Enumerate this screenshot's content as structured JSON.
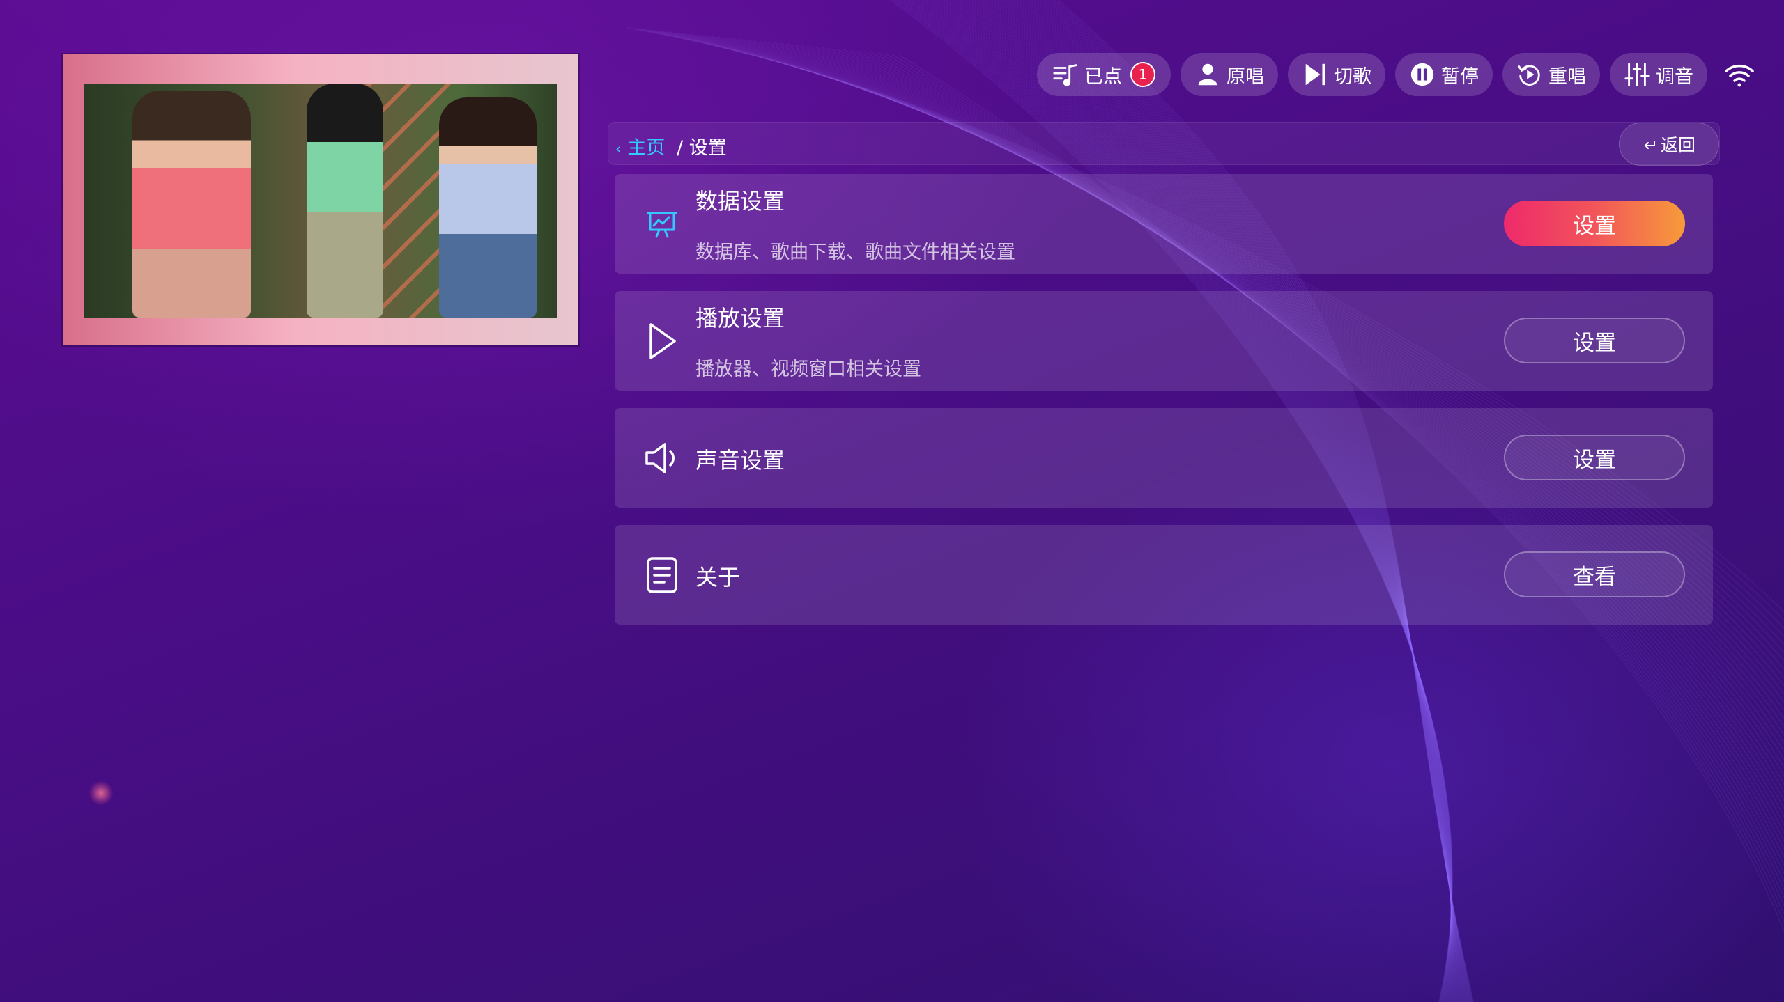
{
  "toolbar": {
    "queued": {
      "label": "已点",
      "count": "1",
      "icon": "playlist-icon"
    },
    "original": {
      "label": "原唱",
      "icon": "singer-icon"
    },
    "skip": {
      "label": "切歌",
      "icon": "skip-icon"
    },
    "pause": {
      "label": "暂停",
      "icon": "pause-icon"
    },
    "replay": {
      "label": "重唱",
      "icon": "replay-icon"
    },
    "tune": {
      "label": "调音",
      "icon": "equalizer-icon"
    },
    "wifi_icon": "wifi-icon"
  },
  "breadcrumb": {
    "home": "主页",
    "home_prefix": "‹",
    "separator": "/",
    "current": "设置",
    "back_label": "返回",
    "back_icon": "return-arrow-icon"
  },
  "settings": [
    {
      "icon": "presentation-chart-icon",
      "title": "数据设置",
      "description": "数据库、歌曲下载、歌曲文件相关设置",
      "button": "设置"
    },
    {
      "icon": "play-icon",
      "title": "播放设置",
      "description": "播放器、视频窗口相关设置",
      "button": "设置"
    },
    {
      "icon": "speaker-icon",
      "title": "声音设置",
      "description": "",
      "button": "设置"
    },
    {
      "icon": "document-icon",
      "title": "关于",
      "description": "",
      "button": "查看"
    }
  ],
  "colors": {
    "accent_link": "#35c8ff",
    "primary_button_start": "#ee2a6b",
    "primary_button_end": "#f79b3a",
    "badge": "#e8214f",
    "background": "#4a0d86"
  }
}
